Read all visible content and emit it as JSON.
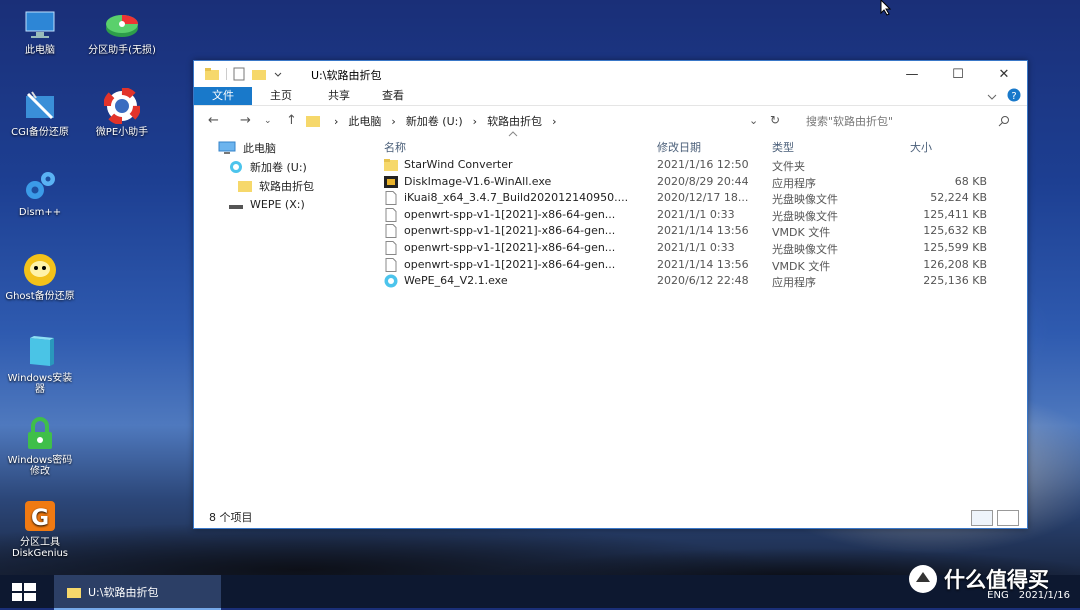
{
  "desktop": {
    "icons": [
      {
        "label": "此电脑"
      },
      {
        "label": "分区助手(无损)"
      },
      {
        "label": "CGI备份还原"
      },
      {
        "label": "微PE小助手"
      },
      {
        "label": "Dism++"
      },
      {
        "label": "Ghost备份还原"
      },
      {
        "label": "Windows安装器"
      },
      {
        "label": "Windows密码修改"
      },
      {
        "label": "分区工具DiskGenius"
      }
    ]
  },
  "window": {
    "title": "U:\\软路由折包",
    "ribbon_tabs": [
      "文件",
      "主页",
      "共享",
      "查看"
    ],
    "breadcrumb": [
      "此电脑",
      "新加卷 (U:)",
      "软路由折包"
    ],
    "search_placeholder": "搜索\"软路由折包\"",
    "nav_tree": [
      "此电脑",
      "新加卷 (U:)",
      "软路由折包",
      "WEPE (X:)"
    ],
    "columns": [
      "名称",
      "修改日期",
      "类型",
      "大小"
    ],
    "files": [
      {
        "name": "StarWind Converter",
        "date": "2021/1/16 12:50",
        "type": "文件夹",
        "size": "",
        "icon": "folder-icon"
      },
      {
        "name": "DiskImage-V1.6-WinAll.exe",
        "date": "2020/8/29 20:44",
        "type": "应用程序",
        "size": "68 KB",
        "icon": "app-icon"
      },
      {
        "name": "iKuai8_x64_3.4.7_Build202012140950....",
        "date": "2020/12/17 18...",
        "type": "光盘映像文件",
        "size": "52,224 KB",
        "icon": "file-icon"
      },
      {
        "name": "openwrt-spp-v1-1[2021]-x86-64-gen...",
        "date": "2021/1/1 0:33",
        "type": "光盘映像文件",
        "size": "125,411 KB",
        "icon": "file-icon"
      },
      {
        "name": "openwrt-spp-v1-1[2021]-x86-64-gen...",
        "date": "2021/1/14 13:56",
        "type": "VMDK 文件",
        "size": "125,632 KB",
        "icon": "file-icon"
      },
      {
        "name": "openwrt-spp-v1-1[2021]-x86-64-gen...",
        "date": "2021/1/1 0:33",
        "type": "光盘映像文件",
        "size": "125,599 KB",
        "icon": "file-icon"
      },
      {
        "name": "openwrt-spp-v1-1[2021]-x86-64-gen...",
        "date": "2021/1/14 13:56",
        "type": "VMDK 文件",
        "size": "126,208 KB",
        "icon": "file-icon"
      },
      {
        "name": "WePE_64_V2.1.exe",
        "date": "2020/6/12 22:48",
        "type": "应用程序",
        "size": "225,136 KB",
        "icon": "wepe-icon"
      }
    ],
    "status": "8 个项目"
  },
  "taskbar": {
    "item_label": "U:\\软路由折包",
    "tray_lang": "ENG",
    "tray_date": "2021/1/16"
  },
  "watermark": "什么值得买",
  "colors": {
    "accent": "#1979ca",
    "folder": "#f6d86b"
  }
}
